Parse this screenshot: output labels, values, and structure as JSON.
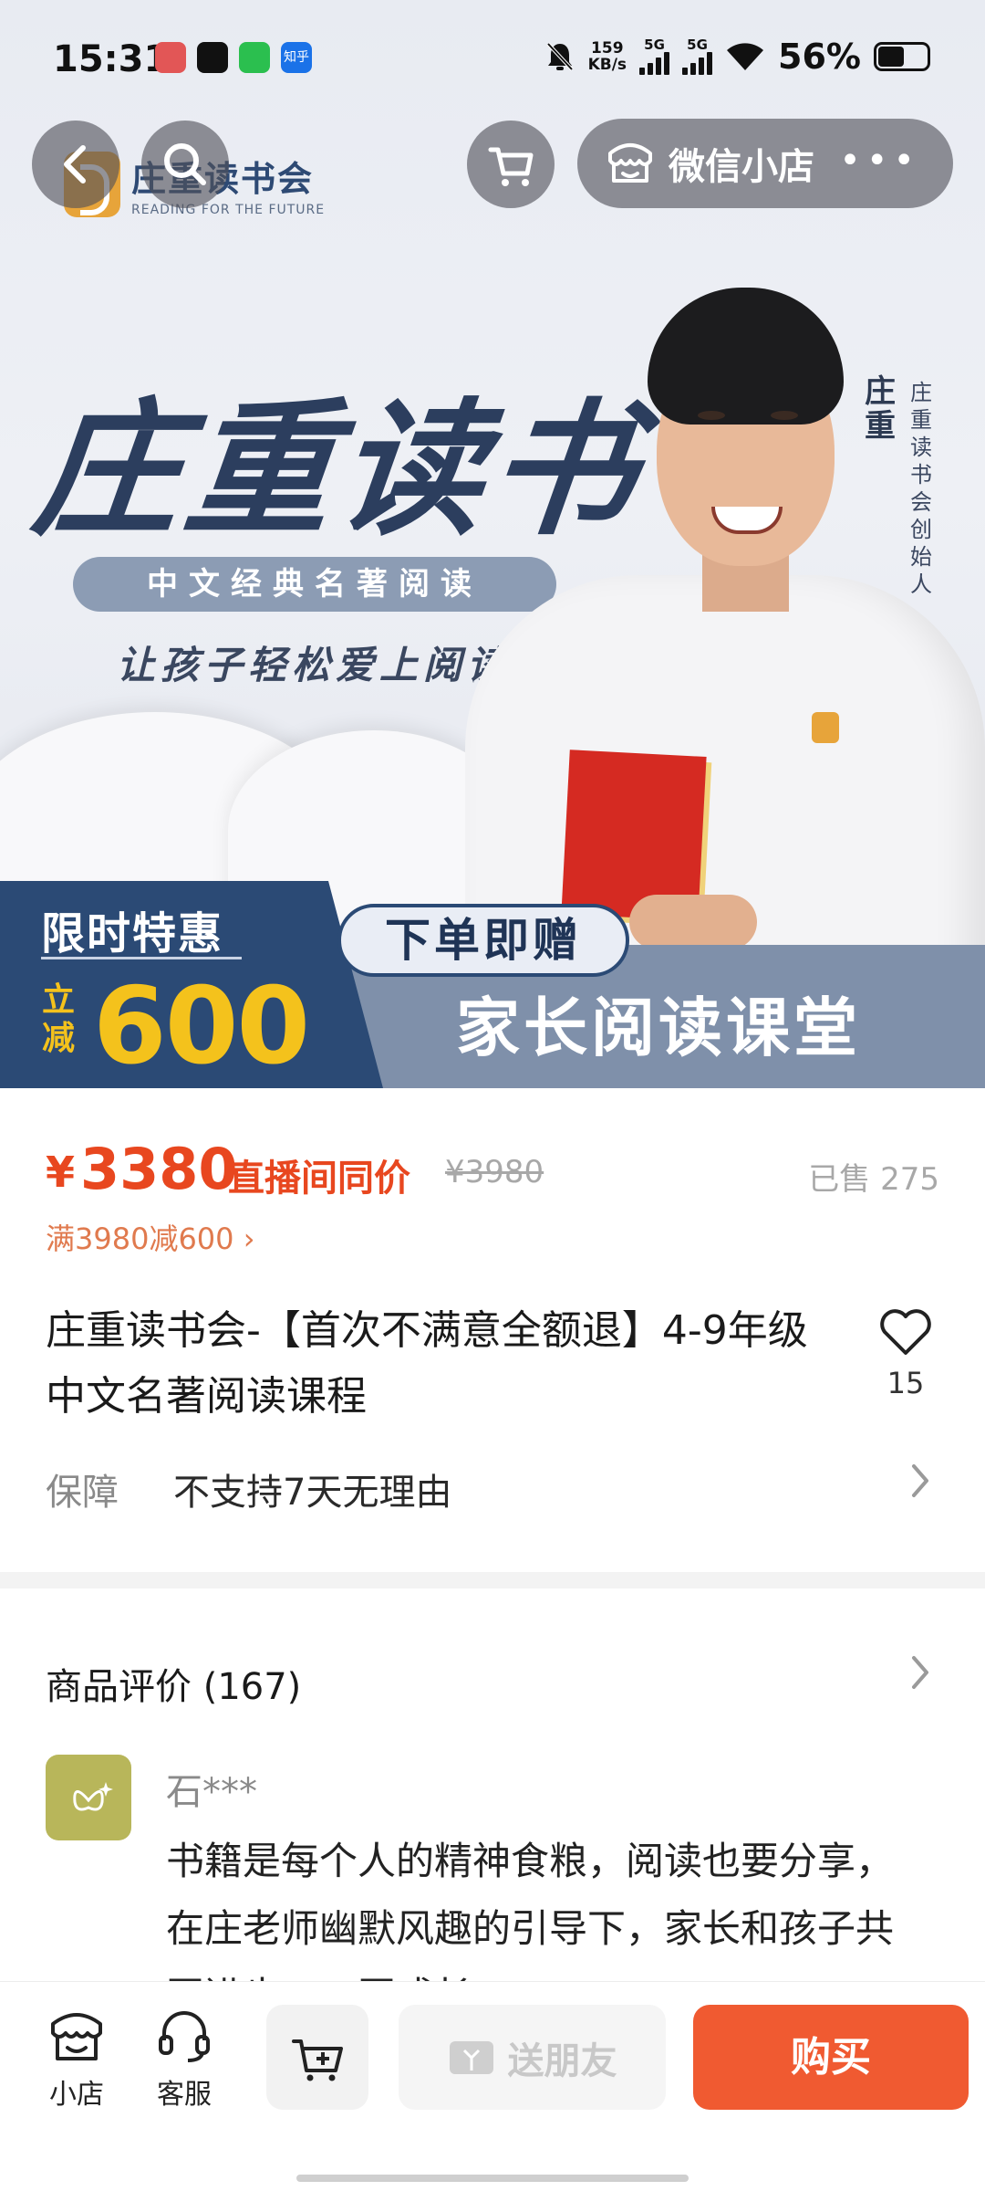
{
  "status_bar": {
    "time": "15:31",
    "net_speed_top": "159",
    "net_speed_bottom": "KB/s",
    "signal1_label": "5G",
    "signal2_label": "5G",
    "battery_text": "56%",
    "battery_level": 0.56,
    "app_icons": [
      "app-icon",
      "tiktok-icon",
      "wechat-icon",
      "zhihu-icon"
    ],
    "zhihu_label": "知乎"
  },
  "header": {
    "shop_label": "微信小店",
    "more_label": "•••"
  },
  "banner": {
    "logo_cn": "庄重读书会",
    "logo_en": "READING FOR THE FUTURE",
    "title": "庄重读书",
    "subtitle": "中文经典名著阅读",
    "slogan": "让孩子轻松爱上阅读",
    "person_name": "庄重",
    "person_role": "庄重读书会创始人",
    "promo_label": "限时特惠",
    "promo_prefix": "立减",
    "promo_amount": "600",
    "gift_label": "下单即赠",
    "gift_content": "家长阅读课堂"
  },
  "product": {
    "currency": "¥",
    "price": "3380",
    "price_tag": "直播间同价",
    "original_price": "¥3980",
    "sold": "已售 275",
    "promo_rule": "满3980减600 ›",
    "title": "庄重读书会-【首次不满意全额退】4-9年级中文名著阅读课程",
    "fav_count": "15",
    "guarantee_label": "保障",
    "guarantee_value": "不支持7天无理由"
  },
  "reviews": {
    "header": "商品评价 (167)",
    "items": [
      {
        "user": "石***",
        "text": "书籍是每个人的精神食粮，阅读也要分享，在庄老师幽默风趣的引导下，家长和孩子共同进步，一同成长。"
      }
    ]
  },
  "bottom_bar": {
    "shop_label": "小店",
    "service_label": "客服",
    "gift_label": "送朋友",
    "buy_label": "购买"
  },
  "colors": {
    "accent": "#f05a31",
    "price": "#e8471f",
    "banner_navy": "#2b4a75",
    "promo_yellow": "#f4c21c"
  }
}
